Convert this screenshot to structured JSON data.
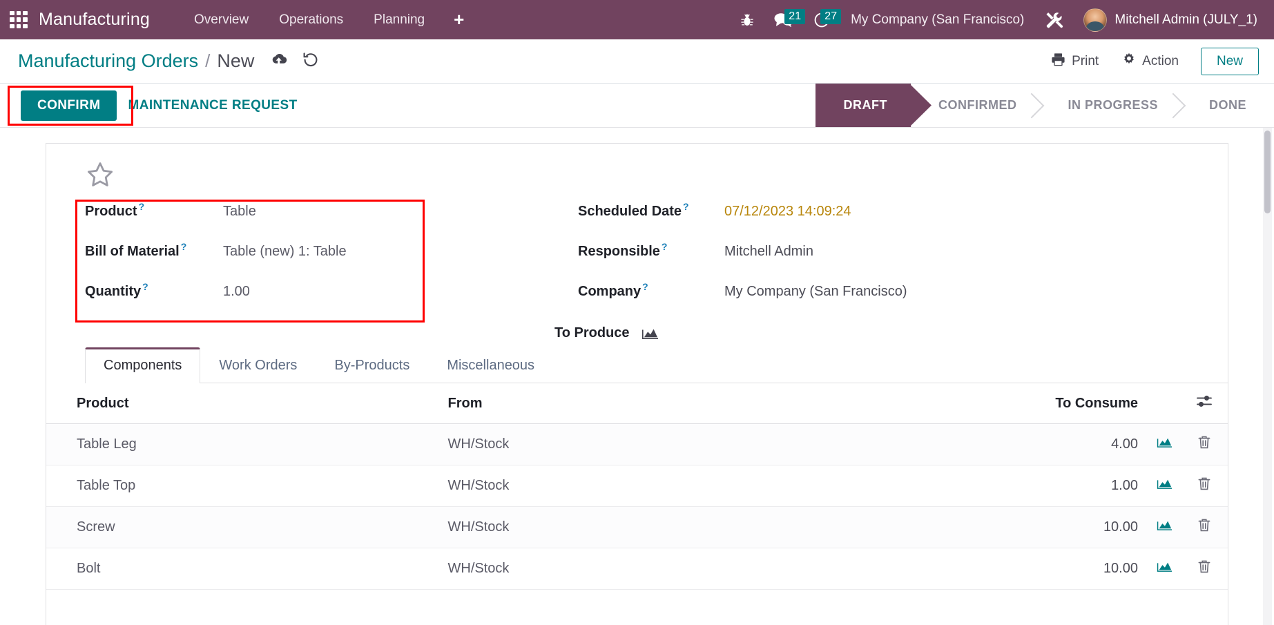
{
  "navbar": {
    "apps_icon": "apps-grid-icon",
    "brand": "Manufacturing",
    "menu": [
      {
        "label": "Overview"
      },
      {
        "label": "Operations"
      },
      {
        "label": "Planning"
      }
    ],
    "plus_label": "+",
    "icons": {
      "debug": "bug-icon",
      "messages": "chat-bubble-icon",
      "activities": "clock-icon",
      "settings": "tools-icon"
    },
    "messages_count": "21",
    "activities_count": "27",
    "company": "My Company (San Francisco)",
    "user_name": "Mitchell Admin (JULY_1)",
    "avatar": "user-avatar",
    "bg_color": "#71435f",
    "badge_color": "#017e84"
  },
  "control_panel": {
    "breadcrumb_parent": "Manufacturing Orders",
    "breadcrumb_separator": "/",
    "breadcrumb_current": "New",
    "save_icon": "cloud-upload-icon",
    "discard_icon": "undo-icon",
    "print_label": "Print",
    "print_icon": "printer-icon",
    "action_label": "Action",
    "action_icon": "gear-icon",
    "new_label": "New",
    "accent_color": "#017e84"
  },
  "statusbar": {
    "confirm_label": "CONFIRM",
    "maintenance_label": "MAINTENANCE REQUEST",
    "stages": [
      {
        "label": "DRAFT",
        "active": true
      },
      {
        "label": "CONFIRMED",
        "active": false
      },
      {
        "label": "IN PROGRESS",
        "active": false
      },
      {
        "label": "DONE",
        "active": false
      }
    ],
    "active_color": "#71435f"
  },
  "form": {
    "star_icon": "star-outline-icon",
    "left_fields": [
      {
        "label": "Product",
        "help": "?",
        "value": "Table"
      },
      {
        "label": "Bill of Material",
        "help": "?",
        "value": "Table (new) 1: Table"
      },
      {
        "label": "Quantity",
        "help": "?",
        "value": "1.00"
      }
    ],
    "right_fields": [
      {
        "label": "Scheduled Date",
        "help": "?",
        "value": "07/12/2023 14:09:24",
        "style": "warn"
      },
      {
        "label": "Responsible",
        "help": "?",
        "value": "Mitchell Admin",
        "style": "dark"
      },
      {
        "label": "Company",
        "help": "?",
        "value": "My Company (San Francisco)",
        "style": "dark"
      }
    ],
    "to_produce_label": "To Produce",
    "to_produce_icon": "forecast-area-chart-icon",
    "warn_color": "#b8860b"
  },
  "tabs": [
    {
      "label": "Components",
      "active": true
    },
    {
      "label": "Work Orders",
      "active": false
    },
    {
      "label": "By-Products",
      "active": false
    },
    {
      "label": "Miscellaneous",
      "active": false
    }
  ],
  "components_table": {
    "columns": {
      "product": "Product",
      "from": "From",
      "to_consume": "To Consume",
      "optional_toggle": "optional-columns-toggle-icon"
    },
    "rows": [
      {
        "product": "Table Leg",
        "from": "WH/Stock",
        "to_consume": "4.00",
        "forecast_icon": "forecast-area-chart-icon",
        "delete_icon": "trash-icon"
      },
      {
        "product": "Table Top",
        "from": "WH/Stock",
        "to_consume": "1.00",
        "forecast_icon": "forecast-area-chart-icon",
        "delete_icon": "trash-icon"
      },
      {
        "product": "Screw",
        "from": "WH/Stock",
        "to_consume": "10.00",
        "forecast_icon": "forecast-area-chart-icon",
        "delete_icon": "trash-icon"
      },
      {
        "product": "Bolt",
        "from": "WH/Stock",
        "to_consume": "10.00",
        "forecast_icon": "forecast-area-chart-icon",
        "delete_icon": "trash-icon"
      }
    ]
  },
  "annotations": [
    {
      "name": "confirm-button-highlight",
      "color": "#ff0000"
    },
    {
      "name": "product-fields-highlight",
      "color": "#ff0000"
    }
  ]
}
